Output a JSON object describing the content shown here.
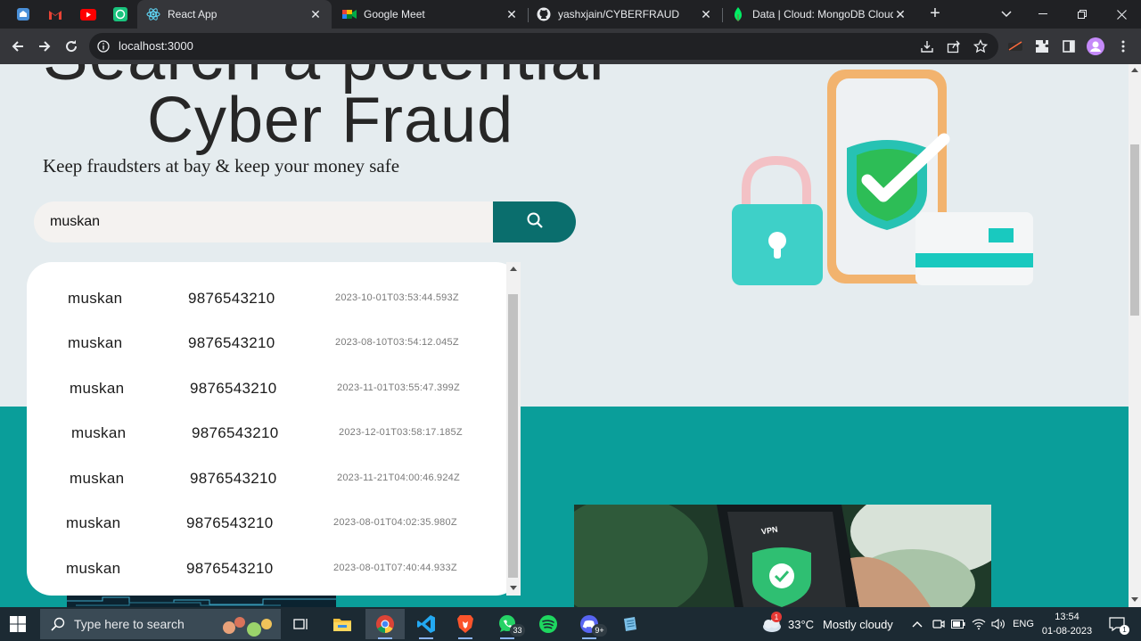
{
  "browser": {
    "tabs": [
      {
        "title": "React App",
        "active": true
      },
      {
        "title": "Google Meet"
      },
      {
        "title": "yashxjain/CYBERFRAUD"
      },
      {
        "title": "Data | Cloud: MongoDB Cloud"
      }
    ],
    "url": "localhost:3000"
  },
  "page": {
    "hero_line1": "Search a potential",
    "hero_line2": "Cyber Fraud",
    "tagline": "Keep fraudsters at bay & keep your money safe",
    "search_value": "muskan",
    "results": [
      {
        "name": "muskan",
        "phone": "9876543210",
        "timestamp": "2023-10-01T03:53:44.593Z"
      },
      {
        "name": "muskan",
        "phone": "9876543210",
        "timestamp": "2023-08-10T03:54:12.045Z"
      },
      {
        "name": "muskan",
        "phone": "9876543210",
        "timestamp": "2023-11-01T03:55:47.399Z"
      },
      {
        "name": "muskan",
        "phone": "9876543210",
        "timestamp": "2023-12-01T03:58:17.185Z"
      },
      {
        "name": "muskan",
        "phone": "9876543210",
        "timestamp": "2023-11-21T04:00:46.924Z"
      },
      {
        "name": "muskan",
        "phone": "9876543210",
        "timestamp": "2023-08-01T04:02:35.980Z"
      },
      {
        "name": "muskan",
        "phone": "9876543210",
        "timestamp": "2023-08-01T07:40:44.933Z"
      }
    ],
    "photo_label": "VPN"
  },
  "taskbar": {
    "search_placeholder": "Type here to search",
    "whatsapp_badge": "33",
    "discord_badge": "9+",
    "weather_alert": "1",
    "temperature": "33°C",
    "weather": "Mostly cloudy",
    "language": "ENG",
    "time": "13:54",
    "date": "01-08-2023",
    "notifications": "1"
  },
  "colors": {
    "page_bg": "#e5ecef",
    "teal_band": "#0a9e9a",
    "search_button": "#0a6e6d",
    "taskbar": "#1c2a33"
  },
  "icons": [
    "home-icon",
    "gmail-icon",
    "youtube-icon",
    "chatgpt-icon",
    "react-icon",
    "google-meet-icon",
    "github-icon",
    "mongodb-icon",
    "search-icon",
    "info-icon",
    "download-icon",
    "share-icon",
    "star-icon",
    "extensions-icon",
    "sidebar-icon",
    "profile-avatar",
    "windows-start-icon"
  ]
}
